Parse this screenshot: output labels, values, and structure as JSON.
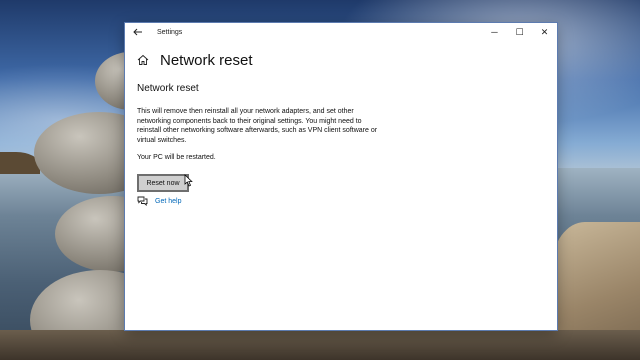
{
  "window": {
    "app_title": "Settings",
    "controls": {
      "minimize": "─",
      "maximize": "☐",
      "close": "✕"
    }
  },
  "page": {
    "title": "Network reset",
    "section_title": "Network reset",
    "description": "This will remove then reinstall all your network adapters, and set other networking components back to their original settings. You might need to reinstall other networking software afterwards, such as VPN client software or virtual switches.",
    "restart_note": "Your PC will be restarted.",
    "reset_button_label": "Reset now",
    "help_link_label": "Get help"
  },
  "icons": {
    "back": "back-arrow-icon",
    "home": "home-icon",
    "help": "chat-help-icon"
  },
  "colors": {
    "link": "#0067b8",
    "window_bg": "#ffffff",
    "button_bg": "#cfcfcf",
    "button_border": "#6e6e6e"
  }
}
